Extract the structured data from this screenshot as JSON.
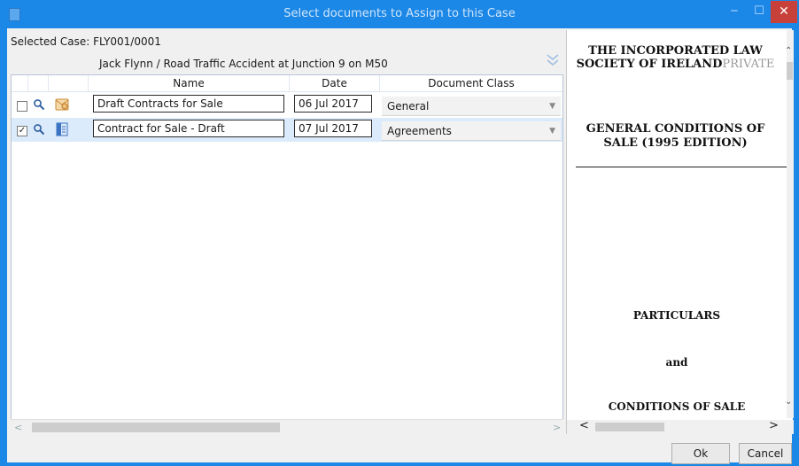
{
  "window": {
    "title": "Select documents to Assign to this Case"
  },
  "case": {
    "label": "Selected Case:",
    "number": "FLY001/0001",
    "description": "Jack Flynn / Road Traffic Accident at Junction 9 on M50"
  },
  "grid": {
    "headers": {
      "name": "Name",
      "date": "Date",
      "class": "Document Class"
    },
    "rows": [
      {
        "checked": "",
        "name": "Draft Contracts for Sale",
        "date": "06 Jul 2017",
        "doc_class": "General",
        "type_icon": "email-envelope-icon"
      },
      {
        "checked": "✓",
        "name": "Contract for Sale - Draft",
        "date": "07 Jul 2017",
        "doc_class": "Agreements",
        "type_icon": "word-document-icon"
      }
    ]
  },
  "preview": {
    "title_bold": "THE INCORPORATED LAW SOCIETY OF IRELAND",
    "title_faded": "PRIVATE",
    "subtitle": "GENERAL CONDITIONS OF SALE (1995 EDITION)",
    "particulars": "PARTICULARS",
    "and": "and",
    "conditions": "CONDITIONS OF SALE"
  },
  "buttons": {
    "ok": "Ok",
    "cancel": "Cancel"
  },
  "colors": {
    "titlebar": "#1b87e6",
    "close": "#c7413a",
    "selected_row": "#dcebfb"
  }
}
